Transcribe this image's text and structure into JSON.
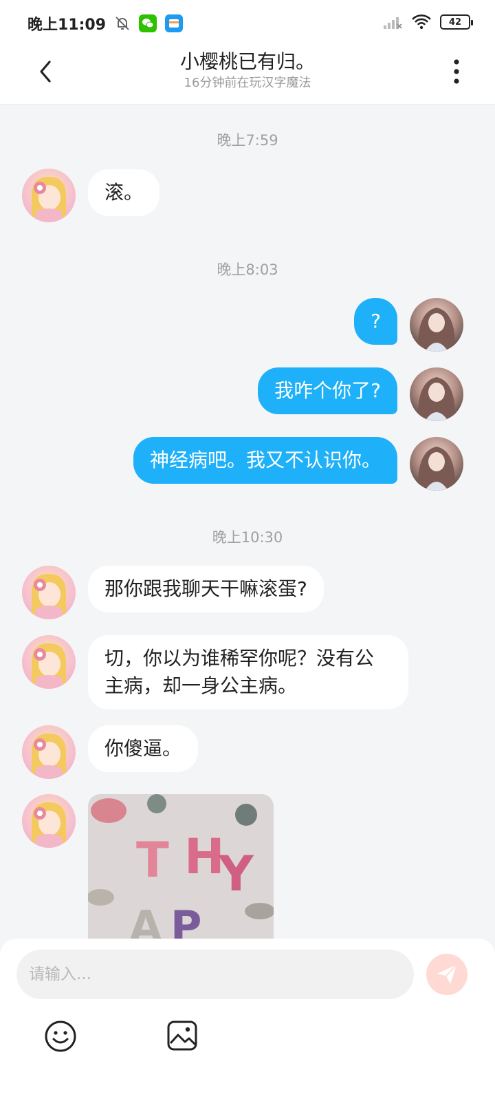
{
  "status_bar": {
    "time": "晚上11:09",
    "battery": "42",
    "icons": [
      "bell-muted-icon",
      "wechat-icon",
      "wallet-icon",
      "signal-icon",
      "wifi-icon",
      "battery-icon"
    ]
  },
  "header": {
    "title": "小樱桃已有归。",
    "subtitle": "16分钟前在玩汉字魔法"
  },
  "messages": {
    "ts1": "晚上7:59",
    "m1": "滚。",
    "ts2": "晚上8:03",
    "m2": "?",
    "m3": "我咋个你了?",
    "m4": "神经病吧。我又不认识你。",
    "ts3": "晚上10:30",
    "m5": "那你跟我聊天干嘛滚蛋?",
    "m6_line1": "切，你以为谁稀罕你呢？没有公",
    "m6_line2": "主病，却一身公主病。",
    "m7": "你傻逼。",
    "image_letters": [
      "T",
      "H",
      "Y",
      "A",
      "P"
    ]
  },
  "input": {
    "placeholder": "请输入..."
  },
  "colors": {
    "outgoing_bubble": "#1eb0f8",
    "incoming_bubble": "#ffffff",
    "background": "#f4f5f7",
    "send_button": "#ffd9d4"
  }
}
